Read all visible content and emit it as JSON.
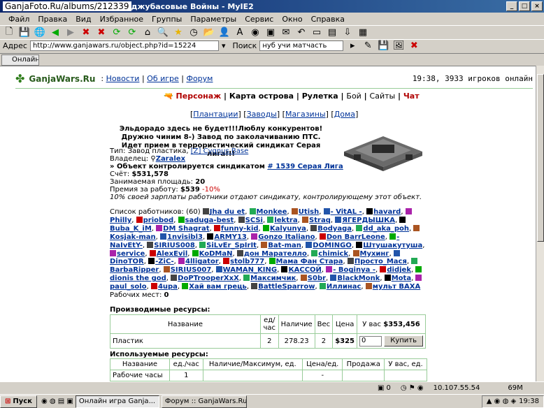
{
  "window": {
    "watermark": "GanjaFoto.Ru/albums/212339",
    "title_rest": "джубасовые Войны - MyIE2"
  },
  "menu": [
    "Файл",
    "Правка",
    "Вид",
    "Избранное",
    "Группы",
    "Параметры",
    "Сервис",
    "Окно",
    "Справка"
  ],
  "address": {
    "label": "Адрес",
    "url": "http://www.ganjawars.ru/object.php?id=15224",
    "search_label": "Поиск",
    "search_value": "нуб учи матчасть"
  },
  "tab": {
    "label": "Онлайн и..."
  },
  "site": {
    "title": "GanjaWars.Ru",
    "links": [
      "Новости",
      "Об игре",
      "Форум"
    ],
    "status": "19:38, 3933 игроков онлайн"
  },
  "nav": [
    "Персонаж",
    "Карта острова",
    "Рулетка",
    "Бой",
    "Сайты",
    "Чат"
  ],
  "subnav": [
    "Плантации",
    "Заводы",
    "Магазины",
    "Дома"
  ],
  "announcement": "Эльдорадо здесь не будет!!!Люблу конкурентов! Дружно чиним 8-) Завод по заколачиванию ПТС. Идет прием в террористический синдикат Серая лига!!!",
  "object": {
    "type_label": "Тип: Завод пластика,",
    "type_location": "[Z] Cygnus Base",
    "owner_label": "Владелец:",
    "owner": "Zaralex",
    "syndicate_text": "» Объект контролируется синдикатом",
    "syndicate": "# 1539 Серая Лига",
    "account_label": "Счёт:",
    "account": "$531,578",
    "area_label": "Занимаемая площадь:",
    "area": "20",
    "bonus_label": "Премия за работу:",
    "bonus": "$539",
    "bonus_pct": "-10%",
    "note": "10% своей зарплаты работники отдают синдикату, контролирующему этот объект."
  },
  "workers": {
    "label": "Список работников: (60)",
    "names": [
      "Jha du et",
      "Monkee",
      "Utish",
      "- VitAL -",
      "havard",
      "Philly",
      "priobod",
      "saduga-best",
      "SCSi",
      "lektra",
      "Straq",
      "ЯГЕРДЫШКА",
      "Buba_K_iM",
      "DM Shagrat",
      "funny-kid",
      "Kalyunya",
      "Bodyaga",
      "dd_aka_poh",
      "Kosjak-man",
      "1nvisibl3",
      "ARMY13",
      "Gonzo Italiano",
      "Don BarrLeone",
      "-NaIvEtY-",
      "SIRIUS008",
      "SiLvEr_SpIrIt",
      "Bat-man",
      "DOMINGO",
      "Штушакутуша",
      "service",
      "AlexEvil",
      "KoDMaN",
      "дон Марателло",
      "chimick",
      "Мухинг",
      "DinoTOR",
      "-ZiC-",
      "4lligator",
      "stolb777",
      "Мама Фан Стара",
      "Просто_Мася",
      "BarbaRipper",
      "SIRIUS007",
      "WAMAN_KING",
      "КАССОЙ",
      "- Boginya -",
      "didjek",
      "dionis the god",
      "DoPTrooperXxX",
      "Максимчик",
      "S0br",
      "BlackMonk",
      "Mota",
      "paul_solo",
      "4upa",
      "Хай вам грець",
      "BattleSparrow",
      "Иллинас",
      "мульт ВАХА"
    ],
    "places_label": "Рабочих мест:",
    "places": "0"
  },
  "produced": {
    "title": "Производимые ресурсы:",
    "headers": [
      "Название",
      "ед/час",
      "Наличие",
      "Вес",
      "Цена"
    ],
    "you_have_label": "У вас",
    "you_have": "$353,456",
    "row": [
      "Пластик",
      "2",
      "278.23",
      "2",
      "$325"
    ],
    "qty": "0",
    "buy": "Купить"
  },
  "used": {
    "title": "Используемые ресурсы:",
    "headers": [
      "Название",
      "ед./час",
      "Наличие/Максимум, ед.",
      "Цена/ед.",
      "Продажа",
      "У вас, ед."
    ],
    "row": [
      "Рабочие часы",
      "1",
      "",
      "-",
      "",
      ""
    ]
  },
  "status": {
    "ip": "10.107.55.54",
    "mem": "69M",
    "count": "0"
  },
  "taskbar": {
    "start": "Пуск",
    "tasks": [
      "Онлайн игра Ganja...",
      "Форум :: GanjaWars.Ru :..."
    ],
    "clock": "19:38"
  }
}
